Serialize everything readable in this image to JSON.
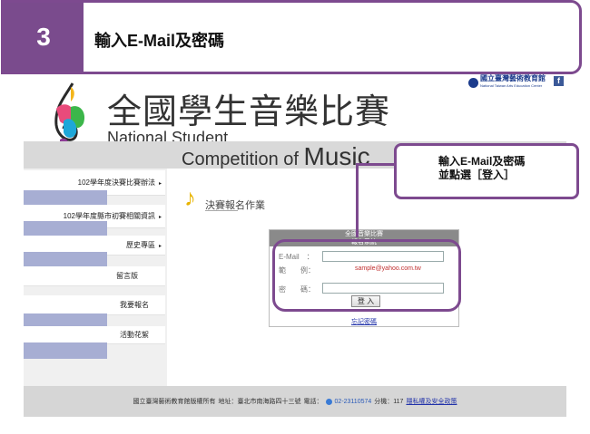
{
  "step": {
    "number": "3",
    "title": "輸入E-Mail及密碼"
  },
  "org_logo": {
    "name": "國立臺灣藝術教育館",
    "name_en": "National Taiwan Arts Education Center",
    "facebook": "f"
  },
  "brand": {
    "zh": "全國學生音樂比賽",
    "en_line1": "National Student",
    "en_line2_prefix": "Competition of ",
    "en_line2_big": "Music"
  },
  "sidebar": {
    "items": [
      {
        "label": "102學年度決賽比賽辦法",
        "arrow": "▸"
      },
      {
        "label": "102學年度縣市初賽相關資訊",
        "arrow": "▸"
      },
      {
        "label": "歷史專區",
        "arrow": "▸"
      },
      {
        "label": "留言版",
        "arrow": ""
      },
      {
        "label": "我要報名",
        "arrow": ""
      },
      {
        "label": "活動花絮",
        "arrow": ""
      }
    ]
  },
  "main": {
    "section_title": "決賽報名作業",
    "login": {
      "header_line1": "全國音樂比賽",
      "header_line2": "報名系統",
      "email_label": "E-Mail　：",
      "example_label": "範　　例：",
      "example_value": "sample@yahoo.com.tw",
      "password_label": "密　　碼：",
      "submit_label": "登 入",
      "forgot_label": "忘記密碼"
    }
  },
  "callout": {
    "line1": "輸入E-Mail及密碼",
    "line2": "並點選［登入］"
  },
  "footer": {
    "copyright": "國立臺灣藝術教育館版權所有",
    "address": "地址：臺北市南海路四十三號",
    "phone_label": "電話：",
    "phone": "02-23110574",
    "ext": "分機：117",
    "privacy": "隱私權及安全政策"
  }
}
